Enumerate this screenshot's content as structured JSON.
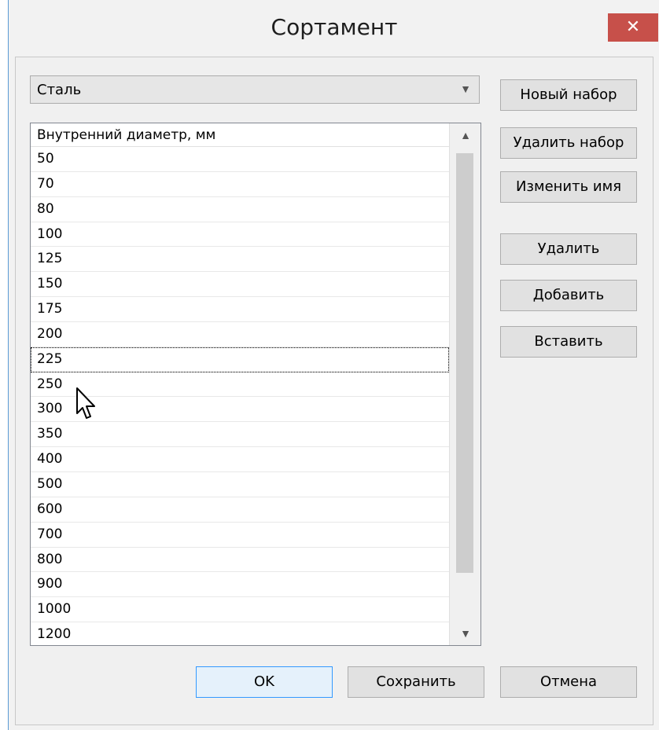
{
  "window": {
    "title": "Сортамент",
    "close_glyph": "✕"
  },
  "material_select": {
    "value": "Сталь",
    "arrow_icon": "chevron-down-icon"
  },
  "list": {
    "header": "Внутренний диаметр, мм",
    "items": [
      "50",
      "70",
      "80",
      "100",
      "125",
      "150",
      "175",
      "200",
      "225",
      "250",
      "300",
      "350",
      "400",
      "500",
      "600",
      "700",
      "800",
      "900",
      "1000",
      "1200"
    ],
    "selected_value": "225"
  },
  "side_buttons": {
    "new_set": "Новый набор",
    "delete_set": "Удалить набор",
    "rename": "Изменить имя",
    "delete": "Удалить",
    "add": "Добавить",
    "insert": "Вставить"
  },
  "bottom_buttons": {
    "ok": "OK",
    "save": "Сохранить",
    "cancel": "Отмена"
  },
  "colors": {
    "close_button": "#c7504a",
    "default_button_border": "#3399ff",
    "window_border": "#5b9bd5"
  }
}
